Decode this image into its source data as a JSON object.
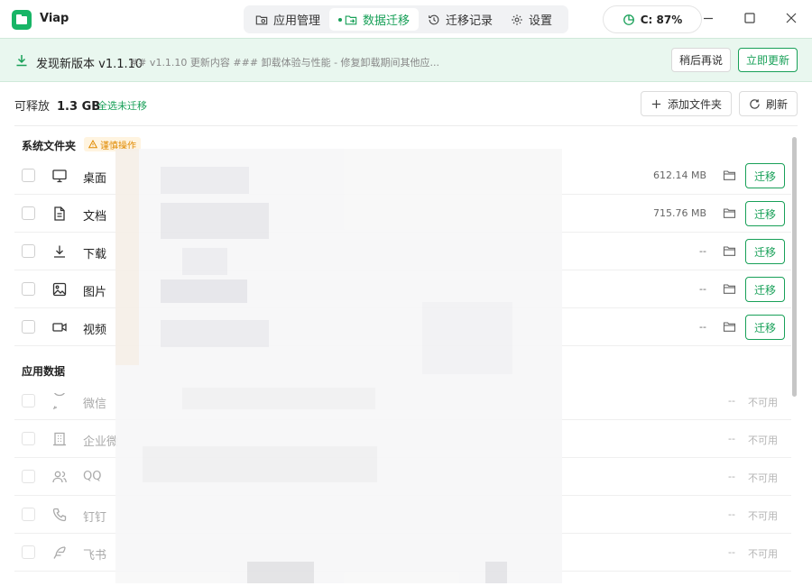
{
  "window": {
    "title": "Viap"
  },
  "nav": {
    "tabs": [
      {
        "label": "应用管理",
        "icon": "folder-icon",
        "active": false
      },
      {
        "label": "数据迁移",
        "icon": "folder-move-icon",
        "active": true
      },
      {
        "label": "迁移记录",
        "icon": "history-icon",
        "active": false
      },
      {
        "label": "设置",
        "icon": "gear-icon",
        "active": false
      }
    ]
  },
  "disk": {
    "label": "C: 87%",
    "usage_percent": 87
  },
  "update": {
    "title": "发现新版本 v1.1.10",
    "notes": "## v1.1.10 更新内容 ### 卸载体验与性能 - 修复卸载期间其他应...",
    "later_label": "稍后再说",
    "update_label": "立即更新"
  },
  "toolbar": {
    "releasable_label": "可释放",
    "releasable_size": "1.3 GB",
    "select_all_label": "全选未迁移",
    "add_folder_label": "添加文件夹",
    "refresh_label": "刷新"
  },
  "system_folders": {
    "title": "系统文件夹",
    "warning": "谨慎操作",
    "items": [
      {
        "label": "桌面",
        "icon": "monitor-icon",
        "size": "612.14 MB",
        "action": "迁移"
      },
      {
        "label": "文档",
        "icon": "document-icon",
        "size": "715.76 MB",
        "action": "迁移"
      },
      {
        "label": "下载",
        "icon": "download-icon",
        "size": "--",
        "action": "迁移"
      },
      {
        "label": "图片",
        "icon": "image-icon",
        "size": "--",
        "action": "迁移"
      },
      {
        "label": "视频",
        "icon": "video-icon",
        "size": "--",
        "action": "迁移"
      }
    ]
  },
  "app_data": {
    "title": "应用数据",
    "items": [
      {
        "label": "微信",
        "icon": "chat-bubble-icon",
        "size": "--",
        "status": "不可用"
      },
      {
        "label": "企业微",
        "icon": "building-icon",
        "size": "--",
        "status": "不可用"
      },
      {
        "label": "QQ",
        "icon": "users-icon",
        "size": "--",
        "status": "不可用"
      },
      {
        "label": "钉钉",
        "icon": "phone-icon",
        "size": "--",
        "status": "不可用"
      },
      {
        "label": "飞书",
        "icon": "feather-icon",
        "size": "--",
        "status": "不可用"
      }
    ]
  },
  "colors": {
    "accent": "#18a058",
    "warning": "#e08a00",
    "banner_bg": "#e9f7ef"
  }
}
